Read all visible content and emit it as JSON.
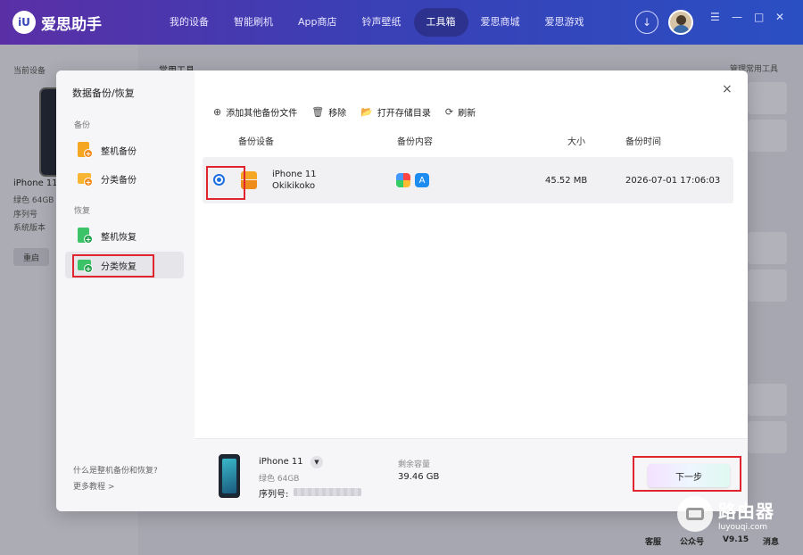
{
  "app": {
    "logo_text": "爱思助手",
    "logo_mark": "iU"
  },
  "nav": {
    "items": [
      "我的设备",
      "智能刷机",
      "App商店",
      "铃声壁纸",
      "工具箱",
      "爱思商城",
      "爱思游戏"
    ],
    "active": "工具箱"
  },
  "window_controls": {
    "menu": "☰",
    "minimize": "—",
    "maximize": "□",
    "close": "✕"
  },
  "background": {
    "current_device_label": "当前设备",
    "common_tools_label": "常用工具",
    "manage_tools_label": "管理常用工具",
    "device_name": "iPhone 11",
    "device_color": "绿色 64GB",
    "serial_label": "序列号",
    "system_label": "系统版本",
    "reboot": "重启",
    "footer": [
      "客服",
      "公众号",
      "V9.15",
      "消息"
    ]
  },
  "modal": {
    "title": "数据备份/恢复",
    "close": "×",
    "sections": [
      {
        "title": "备份",
        "items": [
          {
            "label": "整机备份",
            "icon": "whole-backup-icon"
          },
          {
            "label": "分类备份",
            "icon": "category-backup-icon"
          }
        ]
      },
      {
        "title": "恢复",
        "items": [
          {
            "label": "整机恢复",
            "icon": "whole-restore-icon"
          },
          {
            "label": "分类恢复",
            "icon": "category-restore-icon"
          }
        ]
      }
    ],
    "active_item": "分类恢复",
    "help_question": "什么是整机备份和恢复?",
    "help_more": "更多教程 >",
    "toolbar": [
      {
        "label": "添加其他备份文件",
        "icon": "add-file-icon",
        "glyph": "⊕"
      },
      {
        "label": "移除",
        "icon": "trash-icon",
        "glyph": "🗑"
      },
      {
        "label": "打开存储目录",
        "icon": "folder-icon",
        "glyph": "📂"
      },
      {
        "label": "刷新",
        "icon": "refresh-icon",
        "glyph": "⟳"
      }
    ],
    "table": {
      "headers": {
        "device": "备份设备",
        "content": "备份内容",
        "size": "大小",
        "time": "备份时间"
      },
      "rows": [
        {
          "device_model": "iPhone 11",
          "device_name": "Okikikoko",
          "content_icons": [
            "photos-icon",
            "app-store-icon"
          ],
          "size": "45.52 MB",
          "time": "2026-07-01 17:06:03",
          "selected": true
        }
      ]
    },
    "bottom": {
      "device_name": "iPhone 11",
      "device_color": "绿色 64GB",
      "serial_label": "序列号:",
      "capacity_label": "剩余容量",
      "capacity_value": "39.46 GB",
      "next_button": "下一步"
    }
  },
  "watermark": {
    "title": "路由器",
    "subtitle": "luyouqi.com"
  },
  "colors": {
    "accent_blue": "#1c6fe0",
    "highlight_red": "#e0252f",
    "backup_orange": "#f5a623",
    "restore_green": "#2fb457",
    "topbar_purple": "#5a2fa6"
  }
}
